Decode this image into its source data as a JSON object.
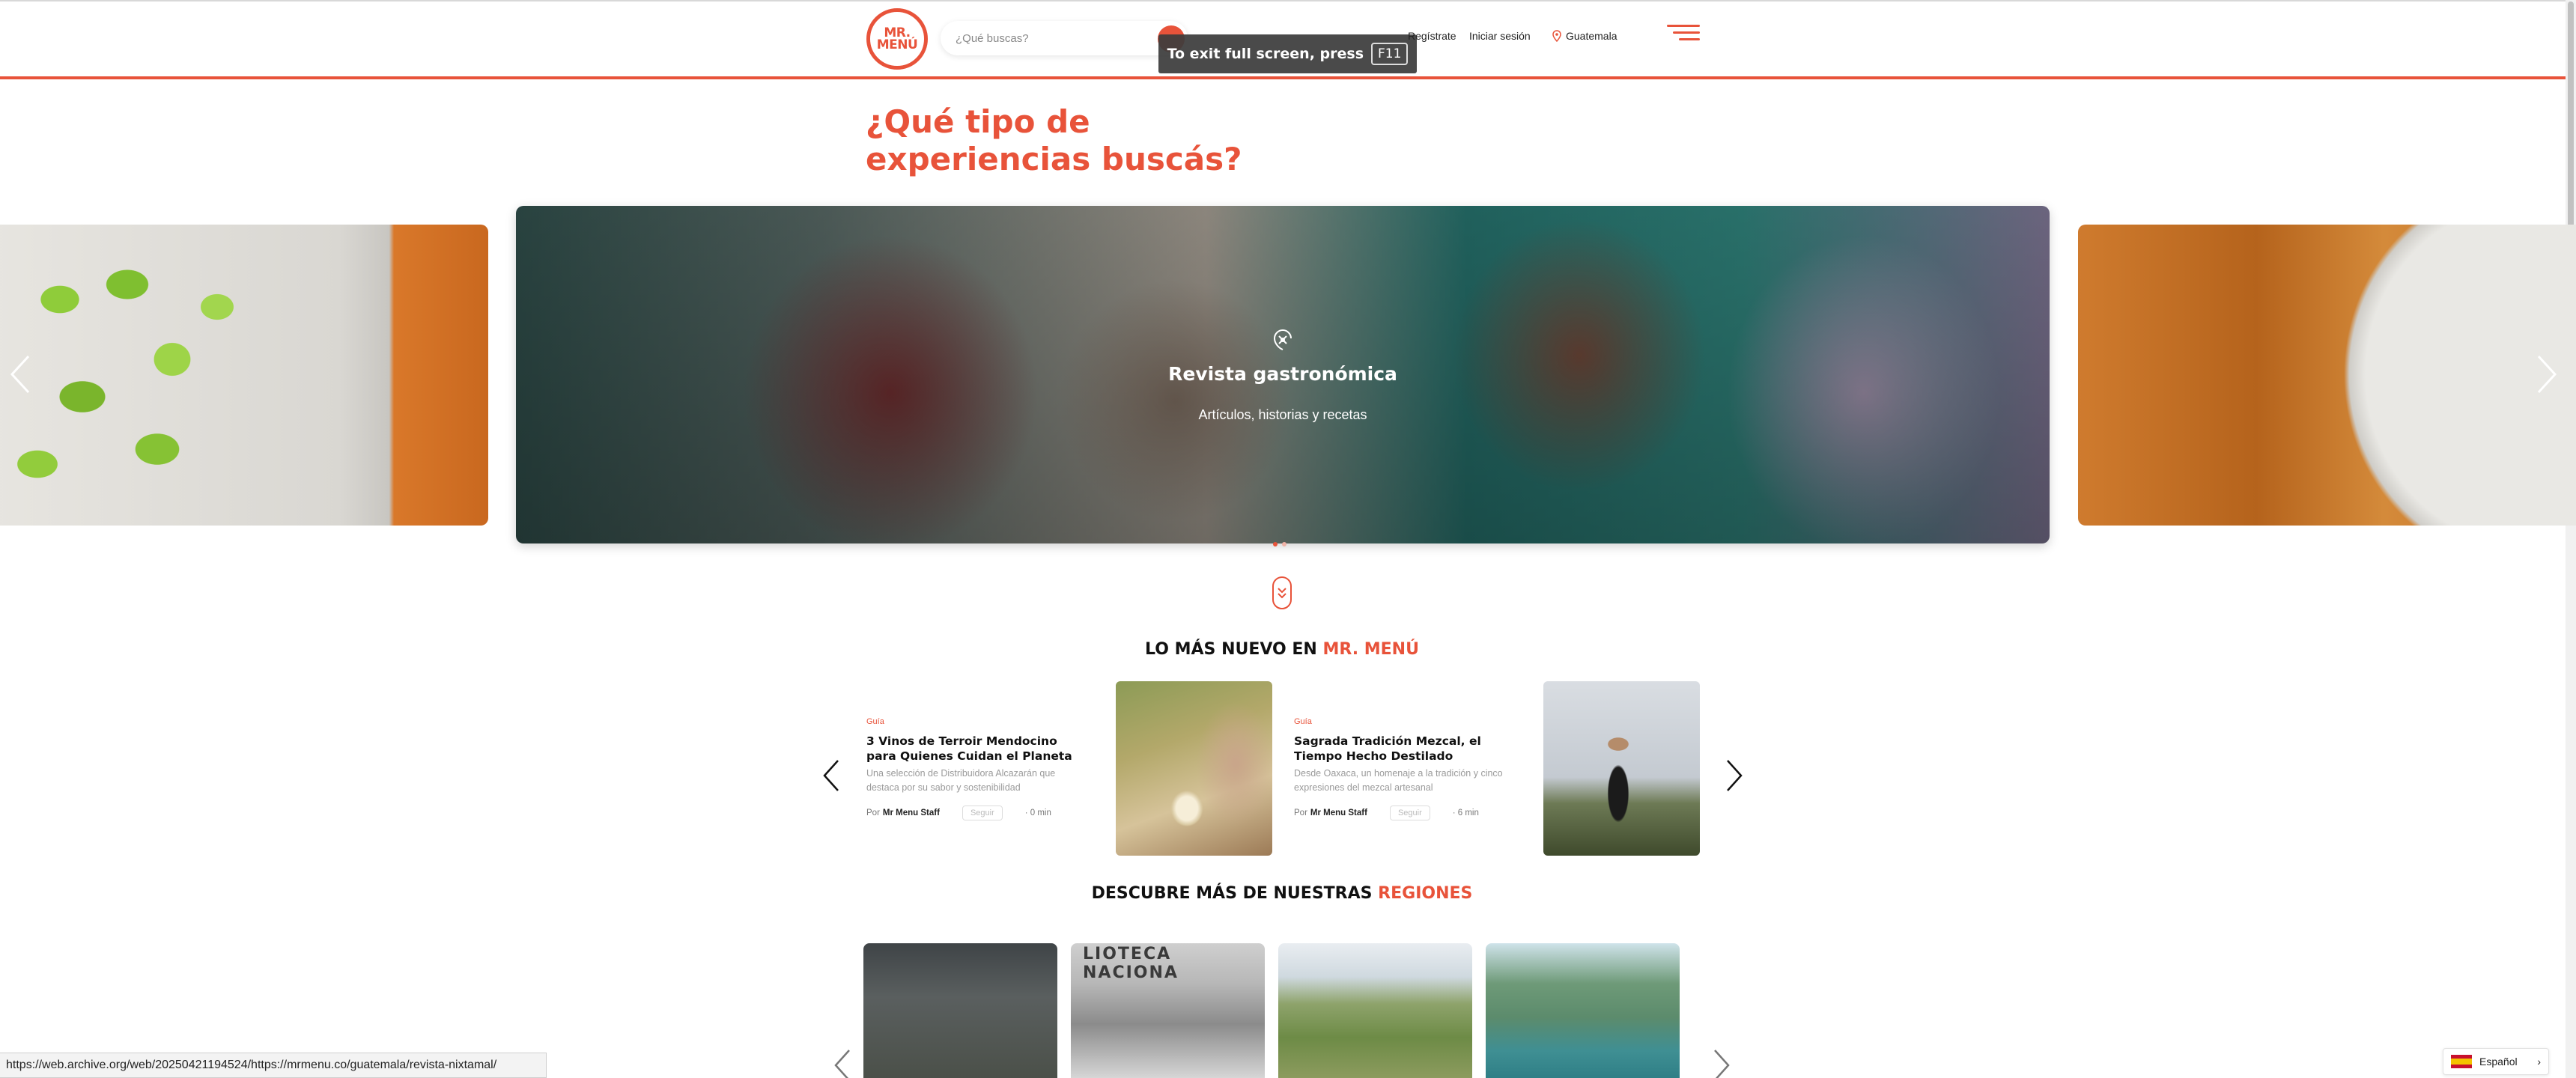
{
  "header": {
    "logo_lines": [
      "MR.",
      "MENÚ"
    ],
    "search_placeholder": "¿Qué buscas?",
    "fullscreen_notice": "To exit full screen, press",
    "fullscreen_key": "F11",
    "register": "Regístrate",
    "login": "Iniciar sesión",
    "location": "Guatemala",
    "accent_color": "#e8533a"
  },
  "hero": {
    "title_line1": "¿Qué tipo de",
    "title_line2": "experiencias buscás?",
    "active_slide": {
      "icon": "magazine-icon",
      "title": "Revista gastronómica",
      "subtitle": "Artículos, historias y recetas"
    }
  },
  "latest": {
    "title_prefix": "LO MÁS NUEVO EN",
    "title_highlight": "MR. MENÚ",
    "articles": [
      {
        "category": "Guía",
        "title": "3 Vinos de Terroir Mendocino para Quienes Cuidan el Planeta",
        "excerpt": "Una selección de Distribuidora Alcazarán que destaca por su sabor y sostenibilidad",
        "by": "Por",
        "author": "Mr Menu Staff",
        "follow": "Seguir",
        "read_time": "· 0 min"
      },
      {
        "category": "Guía",
        "title": "Sagrada Tradición Mezcal, el Tiempo Hecho Destilado",
        "excerpt": "Desde Oaxaca, un homenaje a la tradición y cinco expresiones del mezcal artesanal",
        "by": "Por",
        "author": "Mr Menu Staff",
        "follow": "Seguir",
        "read_time": "· 6 min"
      }
    ]
  },
  "regions": {
    "title_prefix": "DESCUBRE MÁS DE NUESTRAS",
    "title_highlight": "REGIONES",
    "sign_text": "LIOTECA NACIONA"
  },
  "browser": {
    "status_url": "https://web.archive.org/web/20250421194524/https://mrmenu.co/guatemala/revista-nixtamal/",
    "language": "Español"
  }
}
